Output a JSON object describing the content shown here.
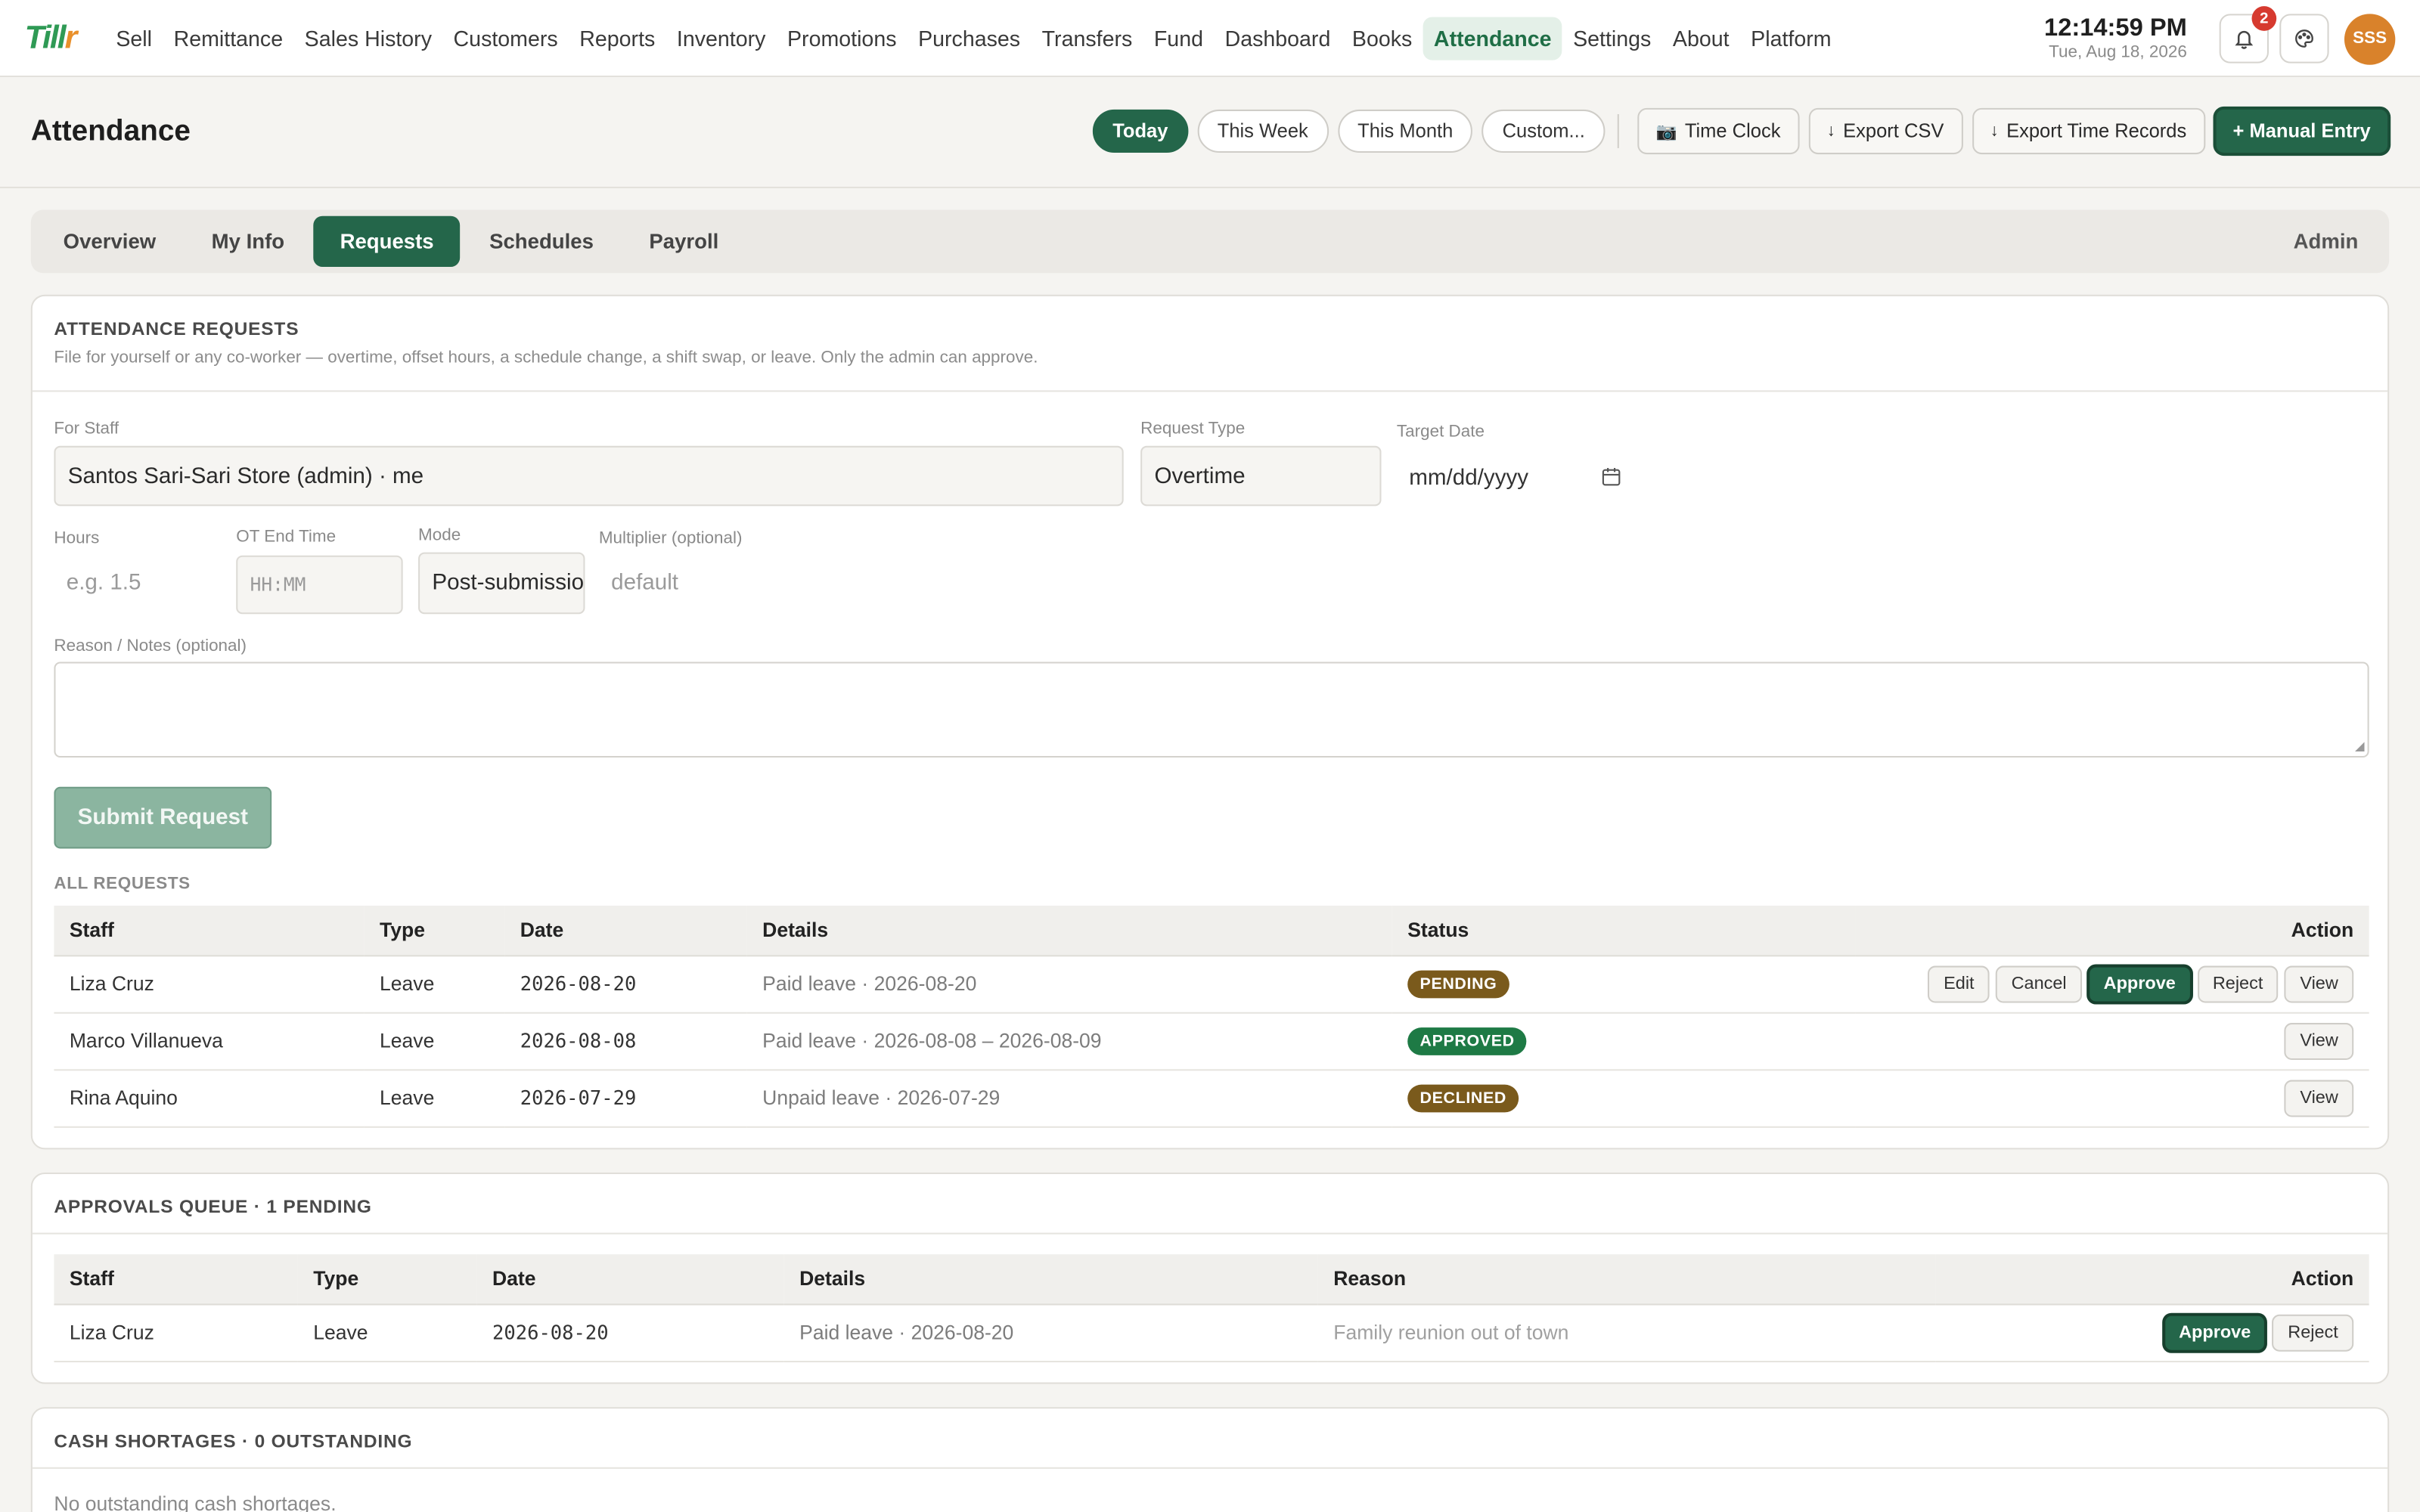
{
  "app": {
    "logo_main": "Till",
    "logo_accent": "r"
  },
  "nav": {
    "items": [
      "Sell",
      "Remittance",
      "Sales History",
      "Customers",
      "Reports",
      "Inventory",
      "Promotions",
      "Purchases",
      "Transfers",
      "Fund",
      "Dashboard",
      "Books",
      "Attendance",
      "Settings",
      "About",
      "Platform"
    ],
    "active": "Attendance"
  },
  "topbar": {
    "time": "12:14:59 PM",
    "date": "Tue, Aug 18, 2026",
    "notification_count": "2",
    "avatar_initials": "SSS",
    "bell_icon": "bell-icon",
    "palette_icon": "palette-icon"
  },
  "header": {
    "title": "Attendance",
    "ranges": [
      "Today",
      "This Week",
      "This Month",
      "Custom..."
    ],
    "active_range": "Today",
    "time_clock": "Time Clock",
    "export_csv": "Export CSV",
    "export_time_records": "Export Time Records",
    "manual_entry": "+ Manual Entry"
  },
  "tabs": {
    "items": [
      "Overview",
      "My Info",
      "Requests",
      "Schedules",
      "Payroll"
    ],
    "active": "Requests",
    "role": "Admin"
  },
  "requests_card": {
    "title": "ATTENDANCE REQUESTS",
    "subtitle": "File for yourself or any co-worker — overtime, offset hours, a schedule change, a shift swap, or leave. Only the admin can approve.",
    "for_staff_label": "For Staff",
    "for_staff_value": "Santos Sari-Sari Store (admin) · me",
    "request_type_label": "Request Type",
    "request_type_value": "Overtime",
    "target_date_label": "Target Date",
    "target_date_placeholder": "mm/dd/yyyy",
    "hours_label": "Hours",
    "hours_placeholder": "e.g. 1.5",
    "ot_end_label": "OT End Time",
    "ot_end_placeholder": "HH:MM",
    "mode_label": "Mode",
    "mode_value": "Post-submission",
    "multiplier_label": "Multiplier (optional)",
    "multiplier_placeholder": "default",
    "reason_label": "Reason / Notes (optional)",
    "submit_label": "Submit Request",
    "all_requests_label": "ALL REQUESTS",
    "columns": [
      "Staff",
      "Type",
      "Date",
      "Details",
      "Status",
      "Action"
    ],
    "rows": [
      {
        "staff": "Liza Cruz",
        "type": "Leave",
        "date": "2026-08-20",
        "details": "Paid leave · 2026-08-20",
        "status": "PENDING"
      },
      {
        "staff": "Marco Villanueva",
        "type": "Leave",
        "date": "2026-08-08",
        "details": "Paid leave · 2026-08-08 – 2026-08-09",
        "status": "APPROVED"
      },
      {
        "staff": "Rina Aquino",
        "type": "Leave",
        "date": "2026-07-29",
        "details": "Unpaid leave · 2026-07-29",
        "status": "DECLINED"
      }
    ],
    "actions": {
      "edit": "Edit",
      "cancel": "Cancel",
      "approve": "Approve",
      "reject": "Reject",
      "view": "View"
    }
  },
  "approvals_card": {
    "title": "APPROVALS QUEUE · 1 PENDING",
    "columns": [
      "Staff",
      "Type",
      "Date",
      "Details",
      "Reason",
      "Action"
    ],
    "rows": [
      {
        "staff": "Liza Cruz",
        "type": "Leave",
        "date": "2026-08-20",
        "details": "Paid leave · 2026-08-20",
        "reason": "Family reunion out of town"
      }
    ],
    "actions": {
      "approve": "Approve",
      "reject": "Reject"
    }
  },
  "shortages_card": {
    "title": "CASH SHORTAGES · 0 OUTSTANDING",
    "empty": "No outstanding cash shortages."
  },
  "colors": {
    "accent": "#24664a",
    "pending": "#7a5a1c",
    "approved": "#1e7a45",
    "avatar": "#d9822b"
  }
}
